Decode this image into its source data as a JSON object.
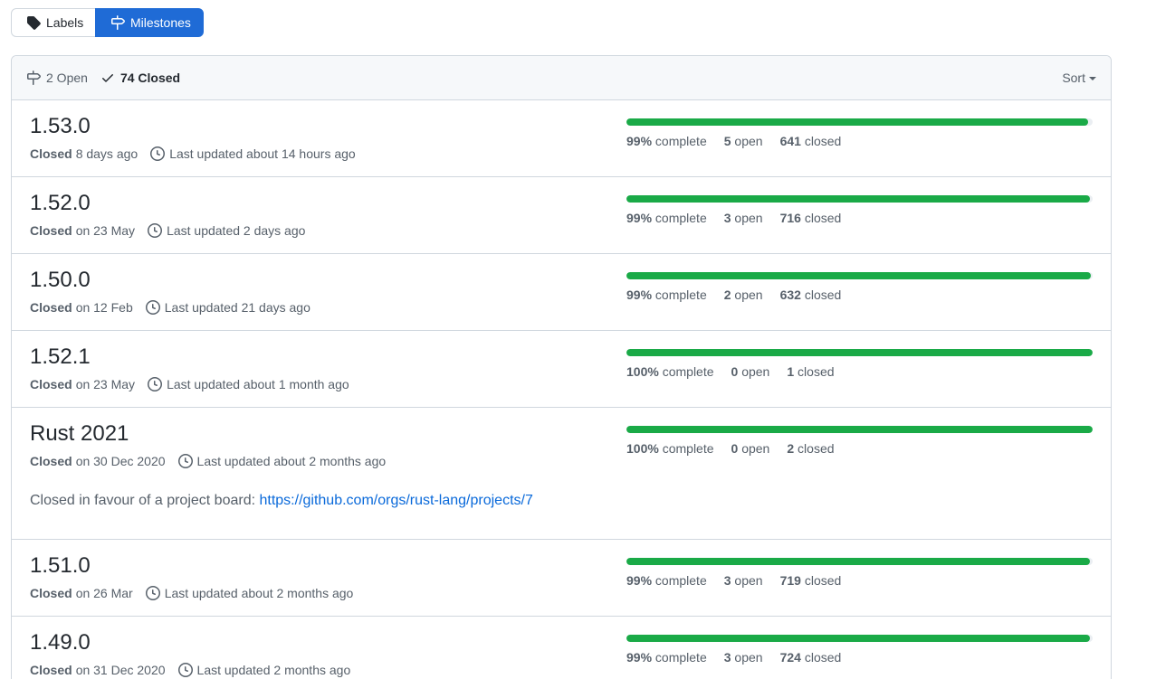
{
  "tabs": {
    "labels": "Labels",
    "milestones": "Milestones"
  },
  "header": {
    "open_label": "2 Open",
    "closed_label": "74 Closed",
    "sort_label": "Sort"
  },
  "milestones": [
    {
      "title": "1.53.0",
      "state": "Closed",
      "closed_when": "8 days ago",
      "updated": "Last updated about 14 hours ago",
      "percent": "99%",
      "percent_value": 99,
      "complete_label": "complete",
      "open_count": "5",
      "open_label": "open",
      "closed_count": "641",
      "closed_label": "closed"
    },
    {
      "title": "1.52.0",
      "state": "Closed",
      "closed_when": "on 23 May",
      "updated": "Last updated 2 days ago",
      "percent": "99%",
      "percent_value": 99.5,
      "complete_label": "complete",
      "open_count": "3",
      "open_label": "open",
      "closed_count": "716",
      "closed_label": "closed"
    },
    {
      "title": "1.50.0",
      "state": "Closed",
      "closed_when": "on 12 Feb",
      "updated": "Last updated 21 days ago",
      "percent": "99%",
      "percent_value": 99.6,
      "complete_label": "complete",
      "open_count": "2",
      "open_label": "open",
      "closed_count": "632",
      "closed_label": "closed"
    },
    {
      "title": "1.52.1",
      "state": "Closed",
      "closed_when": "on 23 May",
      "updated": "Last updated about 1 month ago",
      "percent": "100%",
      "percent_value": 100,
      "complete_label": "complete",
      "open_count": "0",
      "open_label": "open",
      "closed_count": "1",
      "closed_label": "closed"
    },
    {
      "title": "Rust 2021",
      "state": "Closed",
      "closed_when": "on 30 Dec 2020",
      "updated": "Last updated about 2 months ago",
      "percent": "100%",
      "percent_value": 100,
      "complete_label": "complete",
      "open_count": "0",
      "open_label": "open",
      "closed_count": "2",
      "closed_label": "closed",
      "description": "Closed in favour of a project board: ",
      "link": "https://github.com/orgs/rust-lang/projects/7"
    },
    {
      "title": "1.51.0",
      "state": "Closed",
      "closed_when": "on 26 Mar",
      "updated": "Last updated about 2 months ago",
      "percent": "99%",
      "percent_value": 99.4,
      "complete_label": "complete",
      "open_count": "3",
      "open_label": "open",
      "closed_count": "719",
      "closed_label": "closed"
    },
    {
      "title": "1.49.0",
      "state": "Closed",
      "closed_when": "on 31 Dec 2020",
      "updated": "Last updated 2 months ago",
      "percent": "99%",
      "percent_value": 99.4,
      "complete_label": "complete",
      "open_count": "3",
      "open_label": "open",
      "closed_count": "724",
      "closed_label": "closed"
    }
  ]
}
